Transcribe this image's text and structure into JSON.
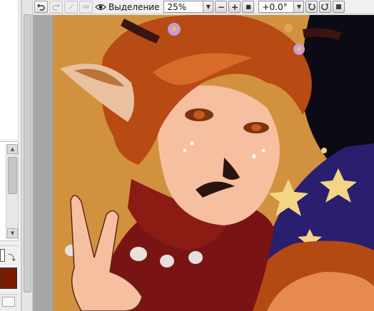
{
  "toolbar": {
    "undo_icon": "undo-icon",
    "redo_icon": "redo-icon",
    "selection_label": "Выделение",
    "zoom_value": "25%",
    "zoom_minus": "−",
    "zoom_plus": "+",
    "zoom_reset": "■",
    "rotation_value": "+0.0°",
    "rotate_left_icon": "rotate-left-icon",
    "rotate_right_icon": "rotate-right-icon",
    "rotate_reset_icon": "rotate-reset-icon"
  },
  "colors": {
    "foreground": "#7a1a00",
    "background": "#ffffff",
    "canvas_bg": "#9a9a9a"
  },
  "left_panel": {
    "scroll_up": "▲",
    "scroll_down": "▼",
    "swap_icon": "⤵"
  }
}
